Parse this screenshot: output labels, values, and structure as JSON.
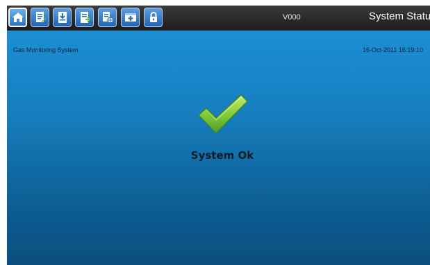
{
  "header": {
    "version": "V000",
    "title": "System Status",
    "toolbar": [
      {
        "icon": "home-icon",
        "active": true
      },
      {
        "icon": "document-edit-icon"
      },
      {
        "icon": "document-import-icon"
      },
      {
        "icon": "document-export-icon"
      },
      {
        "icon": "document-network-icon"
      },
      {
        "icon": "add-window-icon"
      },
      {
        "icon": "lock-icon"
      }
    ]
  },
  "main": {
    "system_name": "Gas Monitoring System",
    "datetime": "16-Oct-2011 16:19:10",
    "status_text": "System Ok",
    "status_icon": "checkmark-icon"
  },
  "colors": {
    "accent": "#1f63b4",
    "check": "#7ac93a"
  }
}
